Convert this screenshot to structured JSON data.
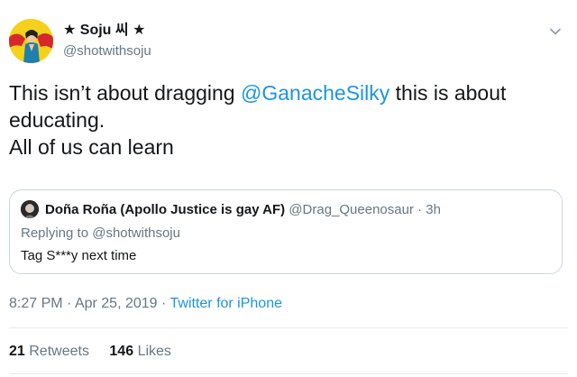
{
  "author": {
    "display_name": "★ Soju 씨 ★",
    "handle": "@shotwithsoju"
  },
  "tweet": {
    "text_before_mention": "This isn’t about dragging ",
    "mention": "@GanacheSilky",
    "text_after_mention": " this is about",
    "line2": "educating.",
    "line3": "All of us can learn"
  },
  "quoted_tweet": {
    "display_name": "Doña Roña (Apollo Justice is gay AF)",
    "handle": "@Drag_Queenosaur",
    "separator": "·",
    "time": "3h",
    "replying_to": "Replying to @shotwithsoju",
    "text": "Tag S***y next time"
  },
  "meta": {
    "time": "8:27 PM",
    "dot": "·",
    "date": "Apr 25, 2019",
    "source": "Twitter for iPhone"
  },
  "stats": {
    "retweets_count": "21",
    "retweets_label": "Retweets",
    "likes_count": "146",
    "likes_label": "Likes"
  },
  "icons": {
    "caret": "chevron-down-icon"
  },
  "colors": {
    "link": "#1b95e0",
    "secondary_text": "#657786",
    "primary_text": "#14171a",
    "border": "#ccd6dd"
  }
}
